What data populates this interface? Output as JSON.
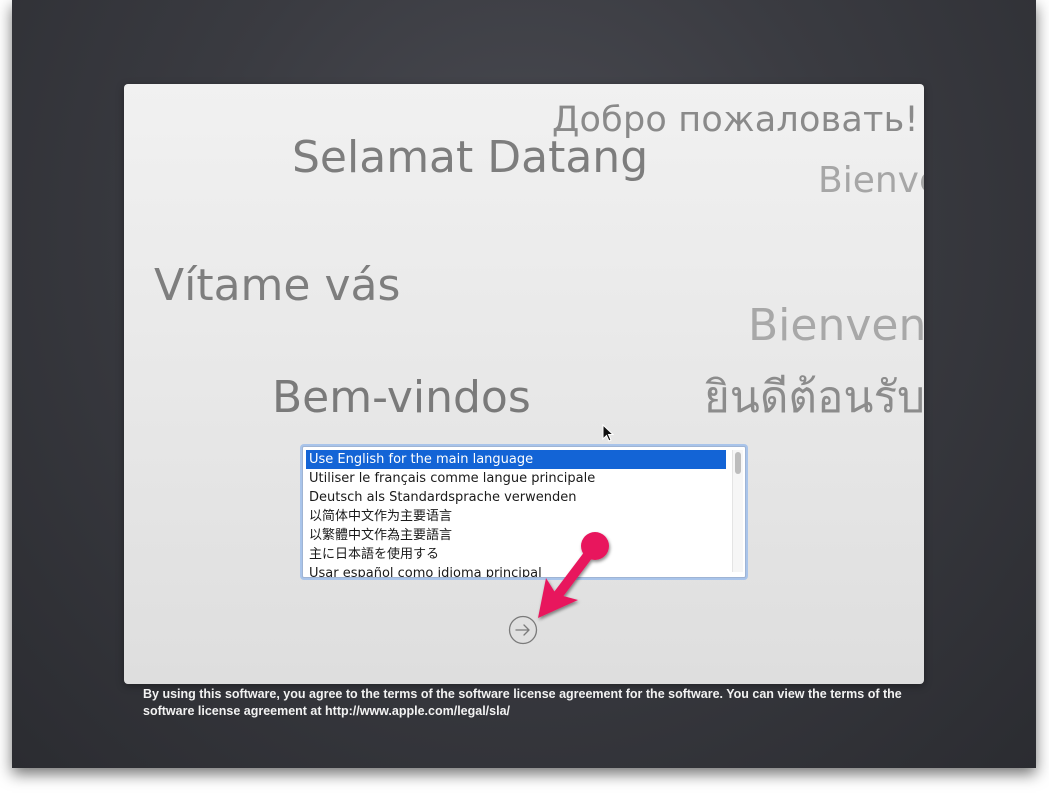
{
  "greetings": {
    "russian": "Добро пожаловать!",
    "malay": "Selamat Datang",
    "french": "Bienve",
    "czech": "Vítame vás",
    "italian": "Bienvenu",
    "thai": "ยินดีต้อนรับ",
    "portuguese": "Bem-vindos"
  },
  "language_list": {
    "items": [
      "Use English for the main language",
      "Utiliser le français comme langue principale",
      "Deutsch als Standardsprache verwenden",
      "以简体中文作为主要语言",
      "以繁體中文作為主要語言",
      "主に日本語を使用する",
      "Usar español como idioma principal"
    ],
    "selected_index": 0
  },
  "next_button": {
    "icon": "arrow-right-circle-icon"
  },
  "annotation": {
    "icon": "pointer-arrow-icon",
    "color": "#e8175d"
  },
  "license": {
    "text": "By using this software, you agree to the terms of the software license agreement for the software. You can view the terms of the software license agreement at http://www.apple.com/legal/sla/"
  },
  "colors": {
    "selection": "#1364d6",
    "background": "#35363c",
    "panel": "#ececec"
  }
}
